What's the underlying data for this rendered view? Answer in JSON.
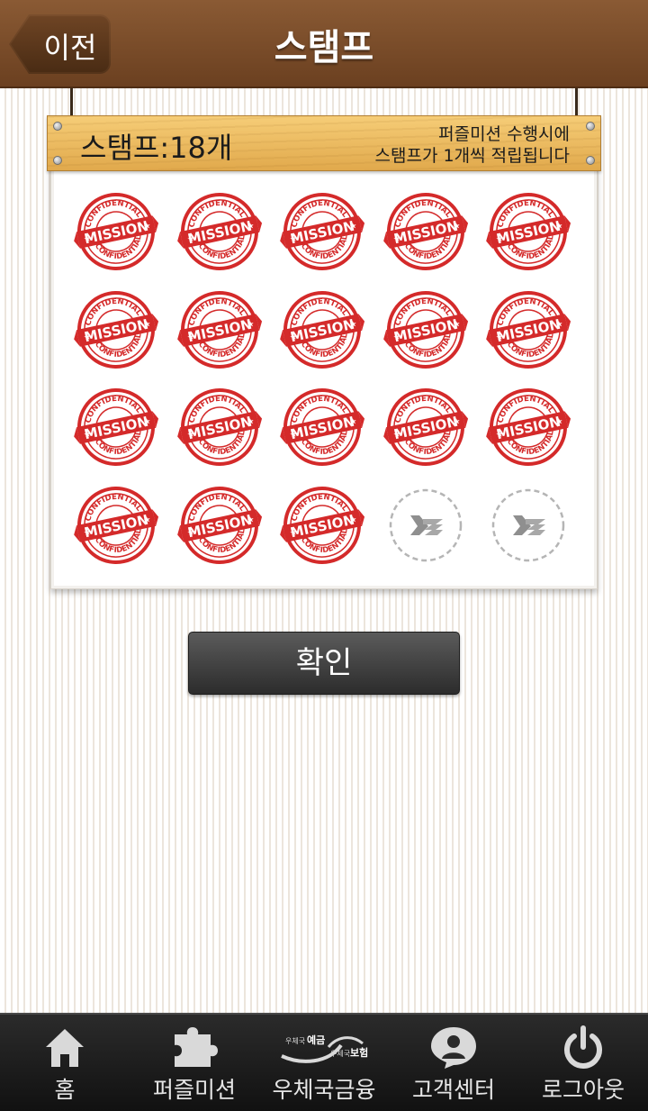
{
  "header": {
    "back_label": "이전",
    "title": "스탬프"
  },
  "board": {
    "stamp_count_label": "스탬프:18개",
    "notice_line1": "퍼즐미션 수행시에",
    "notice_line2": "스탬프가 1개씩 적립됩니다"
  },
  "stamp_text": {
    "top": "CONFIDENTIAL",
    "middle": "MISSION",
    "bottom": "CONFIDENTIAL"
  },
  "stamps": {
    "collected": 18,
    "total": 20,
    "collected_icon": "mission-stamp-icon",
    "empty_icon": "post-logo-placeholder-icon"
  },
  "confirm_label": "확인",
  "nav": {
    "items": [
      {
        "label": "홈",
        "icon": "home-icon"
      },
      {
        "label": "퍼즐미션",
        "icon": "puzzle-icon"
      },
      {
        "label": "우체국금융",
        "icon": "postal-finance-logo-icon",
        "logo_text_left": "우체국",
        "logo_text_left_strong": "예금",
        "logo_text_right": "우체국",
        "logo_text_right_strong": "보험"
      },
      {
        "label": "고객센터",
        "icon": "customer-center-icon"
      },
      {
        "label": "로그아웃",
        "icon": "power-icon"
      }
    ]
  },
  "colors": {
    "header_brown": "#7a4e2c",
    "stamp_red": "#d42a2a",
    "plank_yellow": "#eebd63",
    "nav_dark": "#1e1e1e"
  }
}
